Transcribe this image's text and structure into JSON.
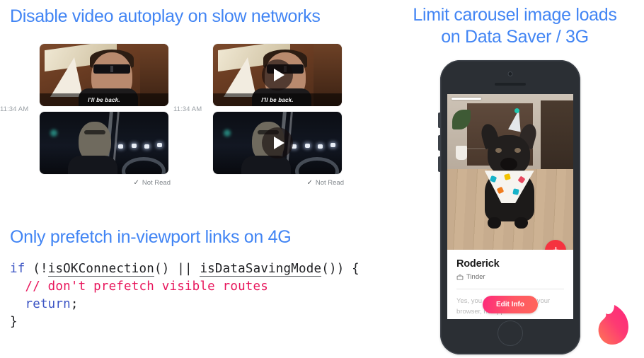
{
  "slides": {
    "autoplay_title": "Disable video autoplay on slow networks",
    "carousel_title_line1": "Limit carousel image loads",
    "carousel_title_line2": "on Data Saver / 3G",
    "prefetch_title": "Only prefetch in-viewport links on 4G"
  },
  "messaging": {
    "left": {
      "timestamp": "11:34 AM",
      "status_label": "Not Read",
      "status_icon": "check-icon",
      "caption": "I'll be back."
    },
    "right": {
      "timestamp": "11:34 AM",
      "status_label": "Not Read",
      "status_icon": "check-icon",
      "caption": "I'll be back.",
      "play_icon": "play-icon"
    }
  },
  "code": {
    "line1_kw": "if",
    "line1_a": " (!",
    "line1_fn1": "isOKConnection",
    "line1_b": "() || ",
    "line1_fn2": "isDataSavingMode",
    "line1_c": "()) {",
    "line2_comment": "  // don't prefetch visible routes",
    "line3_kw": "  return",
    "line3_rest": ";",
    "line4": "}"
  },
  "phone": {
    "card": {
      "name": "Roderick",
      "source_icon": "briefcase-icon",
      "source": "Tinder",
      "description": "Yes, you can use Tinder in your browser, no app needed.",
      "edit_button": "Edit Info",
      "download_icon": "download-arrow-icon"
    },
    "brand_icon": "tinder-flame-icon"
  },
  "colors": {
    "title_blue": "#4285F4",
    "code_keyword": "#3b54c4",
    "code_comment": "#e8165c",
    "tinder_pink": "#fd297b",
    "tinder_orange": "#ff655b",
    "badge_red": "#f5333f"
  }
}
